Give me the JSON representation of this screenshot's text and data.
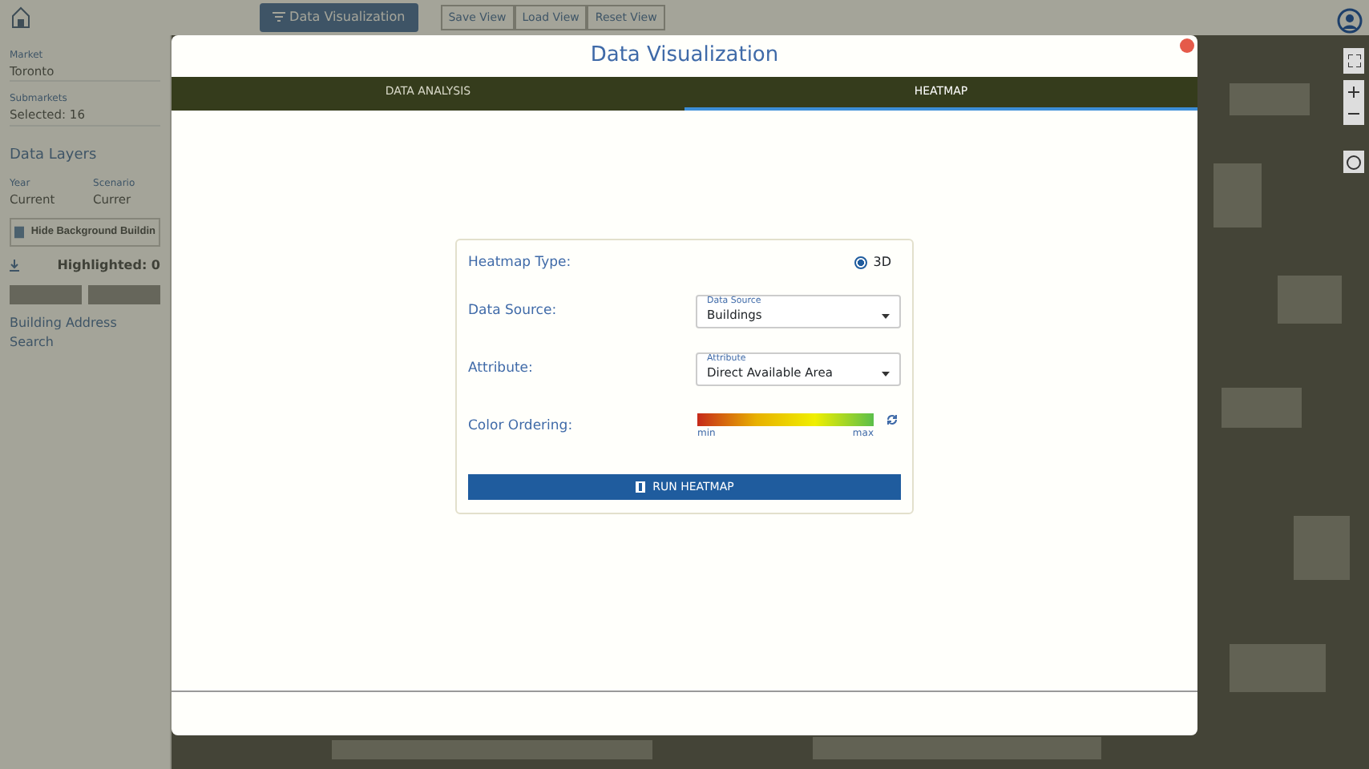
{
  "topbar": {
    "primary_button": "Data Visualization",
    "view_buttons": [
      "Save View",
      "Load View",
      "Reset View"
    ]
  },
  "sidebar": {
    "fields": [
      {
        "label": "Market",
        "value": "Toronto"
      },
      {
        "label": "Submarkets",
        "value": "Selected: 16"
      }
    ],
    "section_title": "Data Layers",
    "selects": [
      {
        "label": "Year",
        "value": "Current"
      },
      {
        "label": "Scenario",
        "value": "Currer"
      }
    ],
    "toggle": {
      "label": "Hide Background Buildin"
    },
    "highlighted": "Highlighted: 0",
    "search_title": "Building Address Search"
  },
  "dialog": {
    "title": "Data Visualization",
    "tabs": [
      {
        "label": "DATA ANALYSIS",
        "selected": false
      },
      {
        "label": "HEATMAP",
        "selected": true
      }
    ],
    "heatmap": {
      "rows": [
        {
          "kind": "radio",
          "label": "Heatmap Type:",
          "option": "3D",
          "checked": true
        },
        {
          "kind": "select",
          "label": "Data Source:",
          "field_label": "Data Source",
          "value": "Buildings"
        },
        {
          "kind": "select",
          "label": "Attribute:",
          "field_label": "Attribute",
          "value": "Direct Available Area"
        },
        {
          "kind": "gradient",
          "label": "Color Ordering:",
          "min": "min",
          "max": "max"
        }
      ],
      "run_button": "RUN HEATMAP"
    }
  }
}
